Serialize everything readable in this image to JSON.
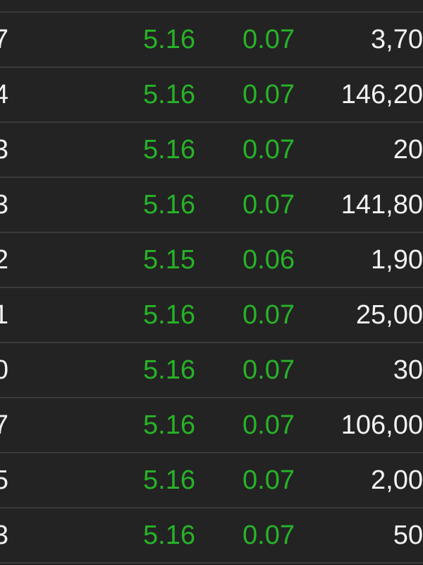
{
  "colors": {
    "background": "#232323",
    "divider": "#3a3a3a",
    "up": "#27b327",
    "text": "#f2f2f2"
  },
  "trades": [
    {
      "time_tail": "7",
      "price": "5.16",
      "change": "0.07",
      "volume": "3,70"
    },
    {
      "time_tail": "4",
      "price": "5.16",
      "change": "0.07",
      "volume": "146,20"
    },
    {
      "time_tail": "3",
      "price": "5.16",
      "change": "0.07",
      "volume": "20"
    },
    {
      "time_tail": "3",
      "price": "5.16",
      "change": "0.07",
      "volume": "141,80"
    },
    {
      "time_tail": "2",
      "price": "5.15",
      "change": "0.06",
      "volume": "1,90"
    },
    {
      "time_tail": "1",
      "price": "5.16",
      "change": "0.07",
      "volume": "25,00"
    },
    {
      "time_tail": "0",
      "price": "5.16",
      "change": "0.07",
      "volume": "30"
    },
    {
      "time_tail": "7",
      "price": "5.16",
      "change": "0.07",
      "volume": "106,00"
    },
    {
      "time_tail": "5",
      "price": "5.16",
      "change": "0.07",
      "volume": "2,00"
    },
    {
      "time_tail": "3",
      "price": "5.16",
      "change": "0.07",
      "volume": "50"
    }
  ]
}
